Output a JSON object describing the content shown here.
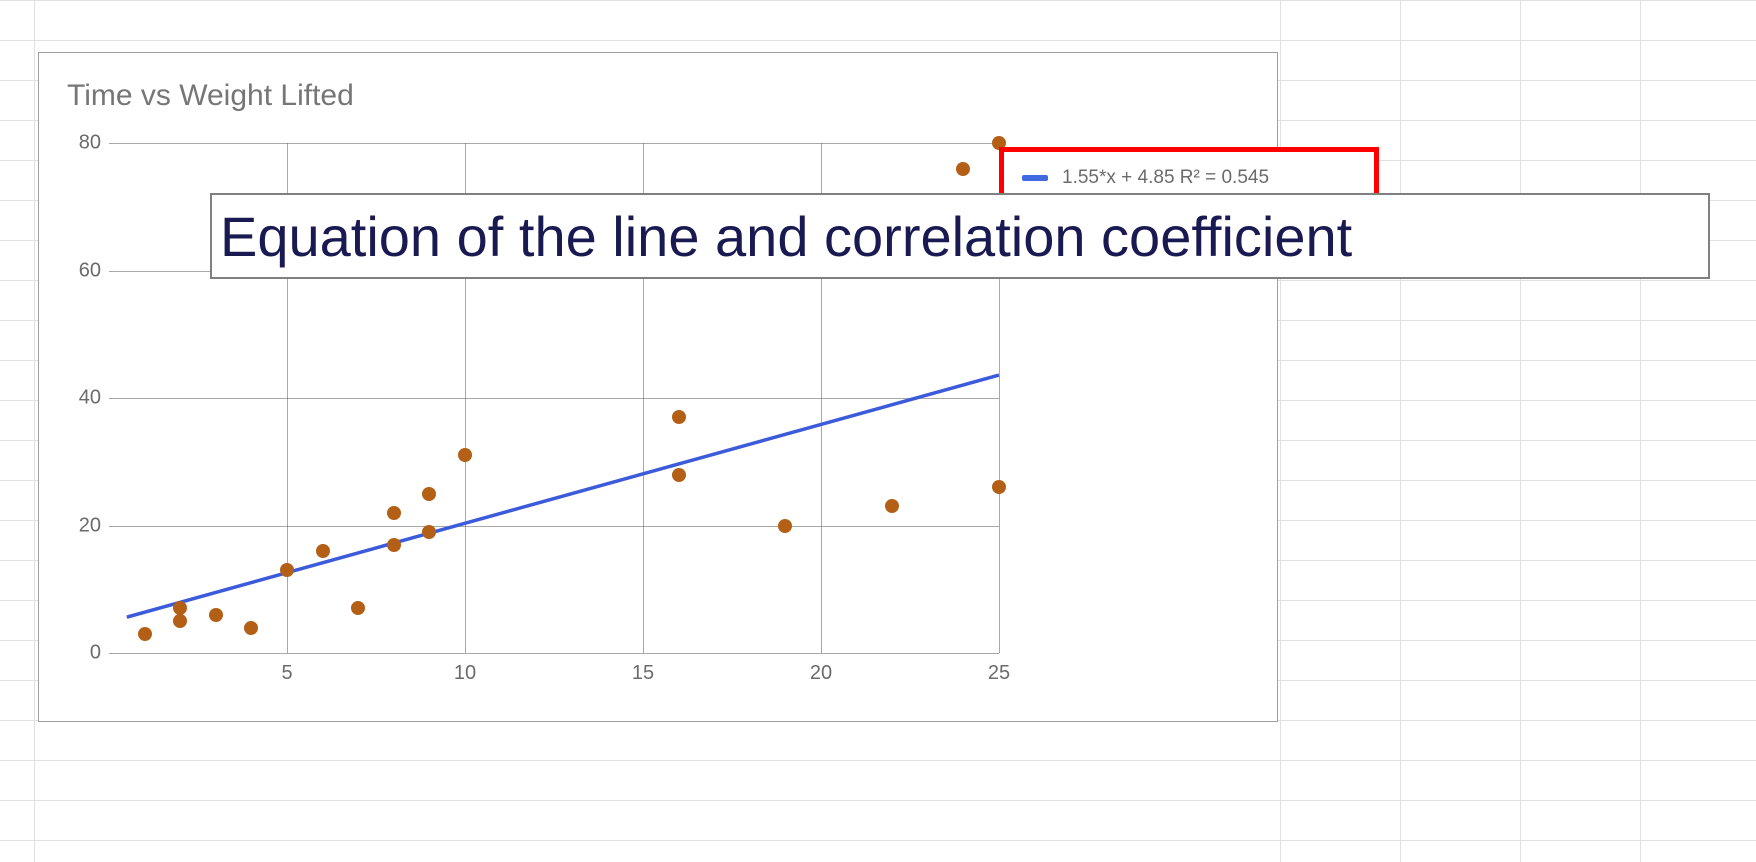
{
  "chart_data": {
    "type": "scatter",
    "title": "Time vs Weight Lifted",
    "xlabel": "",
    "ylabel": "",
    "xlim": [
      0,
      25
    ],
    "ylim": [
      0,
      80
    ],
    "x_ticks": [
      5,
      10,
      15,
      20,
      25
    ],
    "y_ticks": [
      0,
      20,
      40,
      60,
      80
    ],
    "points": [
      {
        "x": 1,
        "y": 3
      },
      {
        "x": 2,
        "y": 7
      },
      {
        "x": 2,
        "y": 5
      },
      {
        "x": 3,
        "y": 6
      },
      {
        "x": 4,
        "y": 4
      },
      {
        "x": 5,
        "y": 13
      },
      {
        "x": 6,
        "y": 16
      },
      {
        "x": 7,
        "y": 7
      },
      {
        "x": 8,
        "y": 22
      },
      {
        "x": 8,
        "y": 17
      },
      {
        "x": 9,
        "y": 25
      },
      {
        "x": 9,
        "y": 19
      },
      {
        "x": 10,
        "y": 31
      },
      {
        "x": 16,
        "y": 37
      },
      {
        "x": 16,
        "y": 28
      },
      {
        "x": 19,
        "y": 20
      },
      {
        "x": 22,
        "y": 23
      },
      {
        "x": 24,
        "y": 76
      },
      {
        "x": 25,
        "y": 80
      },
      {
        "x": 25,
        "y": 26
      }
    ],
    "trendline": {
      "equation": "1.55*x + 4.85",
      "r_squared": 0.545,
      "slope": 1.55,
      "intercept": 4.85
    },
    "legend": {
      "text": "1.55*x + 4.85 R² = 0.545"
    }
  },
  "annotation": {
    "label": "Equation of the line and correlation coefficient"
  }
}
